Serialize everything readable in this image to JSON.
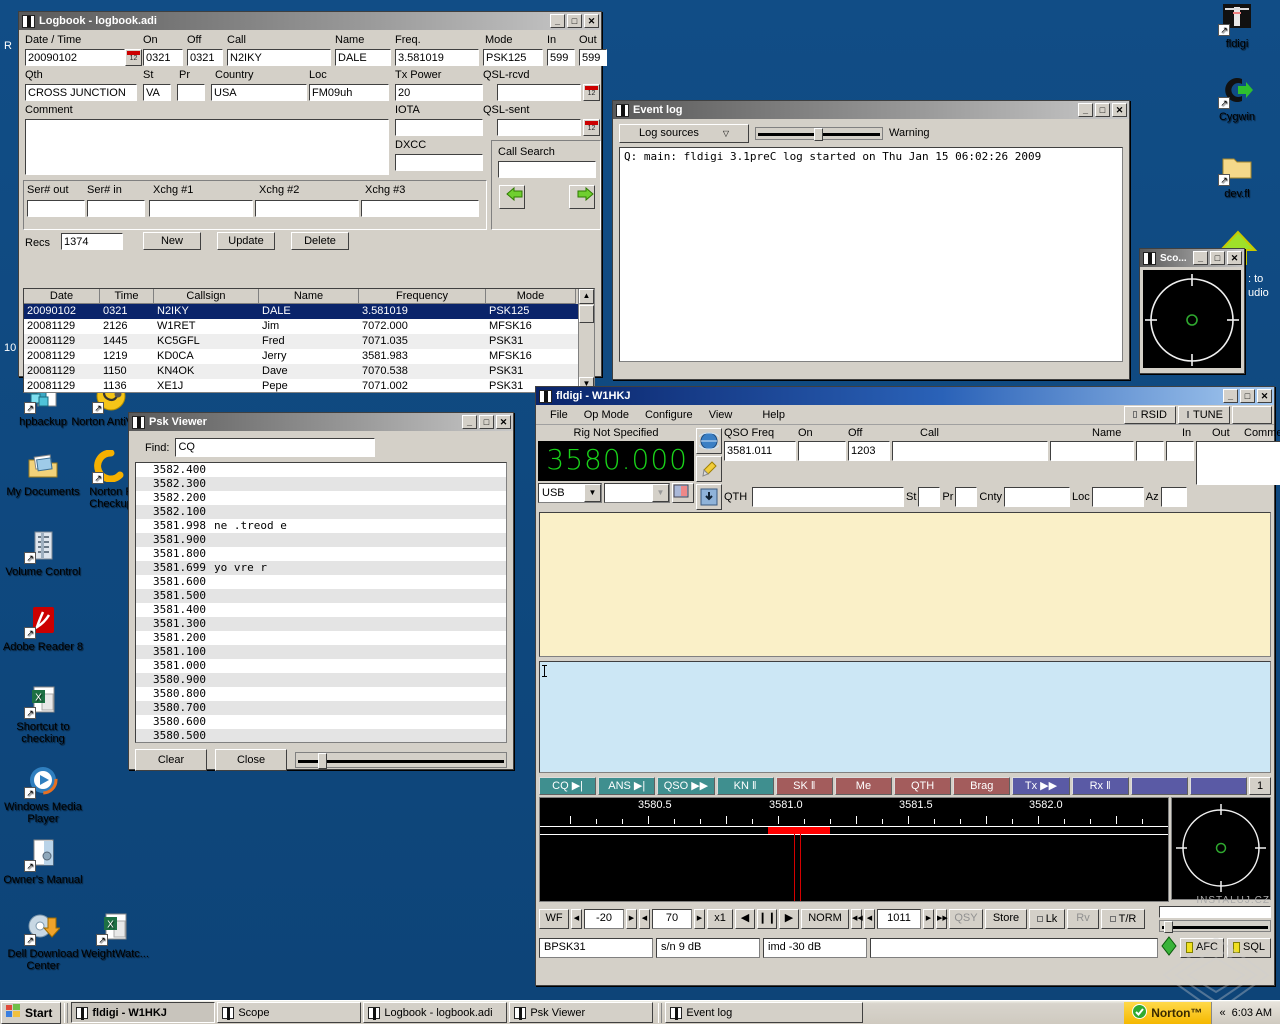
{
  "desktop": {
    "background_color": "#14538c",
    "icons_left": [
      {
        "label": "hpbackup",
        "icon": "backup-icon"
      },
      {
        "label": "Norton AntiVirus",
        "icon": "norton-antivirus-icon"
      },
      {
        "label": "My Documents",
        "icon": "my-documents-icon"
      },
      {
        "label": "Norton P Checkup",
        "icon": "norton-checkup-icon"
      },
      {
        "label": "Volume Control",
        "icon": "volume-control-icon"
      },
      {
        "label": "Adobe Reader 8",
        "icon": "adobe-reader-icon"
      },
      {
        "label": "Shortcut to checking",
        "icon": "excel-sheet-icon"
      },
      {
        "label": "Windows Media Player",
        "icon": "media-player-icon"
      },
      {
        "label": "Owner's Manual",
        "icon": "manual-icon"
      },
      {
        "label": "Dell Download Center",
        "icon": "dell-download-icon"
      },
      {
        "label": "WeightWatc...",
        "icon": "excel-sheet-icon"
      }
    ],
    "icons_right": [
      {
        "label": "fldigi",
        "icon": "fldigi-icon"
      },
      {
        "label": "Cygwin",
        "icon": "cygwin-icon"
      },
      {
        "label": "dev.fl",
        "icon": "folder-icon"
      }
    ],
    "clipped_labels": {
      "left_edge_top": "R",
      "left_edge_mid": "10",
      "right_clip_1": ": to",
      "right_clip_2": "udio"
    }
  },
  "logbook": {
    "title": "Logbook - logbook.adi",
    "labels": {
      "datetime": "Date / Time",
      "on": "On",
      "off": "Off",
      "call": "Call",
      "name": "Name",
      "freq": "Freq.",
      "mode": "Mode",
      "in": "In",
      "out": "Out",
      "qth": "Qth",
      "st": "St",
      "pr": "Pr",
      "country": "Country",
      "loc": "Loc",
      "txpower": "Tx Power",
      "qsl_rcvd": "QSL-rcvd",
      "comment": "Comment",
      "iota": "IOTA",
      "dxcc": "DXCC",
      "qsl_sent": "QSL-sent",
      "call_search": "Call Search",
      "ser_out": "Ser# out",
      "ser_in": "Ser# in",
      "xchg1": "Xchg #1",
      "xchg2": "Xchg #2",
      "xchg3": "Xchg #3",
      "recs": "Recs"
    },
    "values": {
      "datetime": "20090102",
      "on": "0321",
      "off": "0321",
      "call": "N2IKY",
      "name": "DALE",
      "freq": "3.581019",
      "mode": "PSK125",
      "in": "599",
      "out": "599",
      "qth": "CROSS JUNCTION",
      "st": "VA",
      "pr": "",
      "country": "USA",
      "loc": "FM09uh",
      "txpower": "20",
      "qsl_rcvd": "",
      "comment": "",
      "iota": "",
      "dxcc": "",
      "qsl_sent": "",
      "call_search": "",
      "ser_out": "",
      "ser_in": "",
      "xchg1": "",
      "xchg2": "",
      "xchg3": "",
      "recs": "1374"
    },
    "buttons": {
      "new": "New",
      "update": "Update",
      "delete": "Delete"
    },
    "table": {
      "headers": [
        "Date",
        "Time",
        "Callsign",
        "Name",
        "Frequency",
        "Mode"
      ],
      "rows": [
        {
          "date": "20090102",
          "time": "0321",
          "callsign": "N2IKY",
          "name": "DALE",
          "frequency": "3.581019",
          "mode": "PSK125",
          "selected": true
        },
        {
          "date": "20081129",
          "time": "2126",
          "callsign": "W1RET",
          "name": "Jim",
          "frequency": "7072.000",
          "mode": "MFSK16",
          "selected": false
        },
        {
          "date": "20081129",
          "time": "1445",
          "callsign": "KC5GFL",
          "name": "Fred",
          "frequency": "7071.035",
          "mode": "PSK31",
          "selected": false
        },
        {
          "date": "20081129",
          "time": "1219",
          "callsign": "KD0CA",
          "name": "Jerry",
          "frequency": "3581.983",
          "mode": "MFSK16",
          "selected": false
        },
        {
          "date": "20081129",
          "time": "1150",
          "callsign": "KN4OK",
          "name": "Dave",
          "frequency": "7070.538",
          "mode": "PSK31",
          "selected": false
        },
        {
          "date": "20081129",
          "time": "1136",
          "callsign": "XE1J",
          "name": "Pepe",
          "frequency": "7071.002",
          "mode": "PSK31",
          "selected": false
        }
      ]
    }
  },
  "eventlog": {
    "title": "Event log",
    "log_sources_label": "Log sources",
    "level_label": "Warning",
    "text": "Q: main: fldigi 3.1preC log started on Thu Jan 15 06:02:26 2009"
  },
  "scope": {
    "title": "Sco..."
  },
  "pskviewer": {
    "title": "Psk Viewer",
    "find_label": "Find:",
    "find_value": "CQ",
    "buttons": {
      "clear": "Clear",
      "close": "Close"
    },
    "rows": [
      {
        "freq": "3582.400",
        "text": ""
      },
      {
        "freq": "3582.300",
        "text": ""
      },
      {
        "freq": "3582.200",
        "text": ""
      },
      {
        "freq": "3582.100",
        "text": ""
      },
      {
        "freq": "3581.998",
        "text": "ne .treod e"
      },
      {
        "freq": "3581.900",
        "text": ""
      },
      {
        "freq": "3581.800",
        "text": ""
      },
      {
        "freq": "3581.699",
        "text": "yo   vre r"
      },
      {
        "freq": "3581.600",
        "text": ""
      },
      {
        "freq": "3581.500",
        "text": ""
      },
      {
        "freq": "3581.400",
        "text": ""
      },
      {
        "freq": "3581.300",
        "text": ""
      },
      {
        "freq": "3581.200",
        "text": ""
      },
      {
        "freq": "3581.100",
        "text": ""
      },
      {
        "freq": "3581.000",
        "text": ""
      },
      {
        "freq": "3580.900",
        "text": ""
      },
      {
        "freq": "3580.800",
        "text": ""
      },
      {
        "freq": "3580.700",
        "text": ""
      },
      {
        "freq": "3580.600",
        "text": ""
      },
      {
        "freq": "3580.500",
        "text": ""
      }
    ]
  },
  "fldigi": {
    "title": "fldigi - W1HKJ",
    "menu": [
      "File",
      "Op Mode",
      "Configure",
      "View",
      "Help"
    ],
    "toggles": [
      {
        "label": "RSID",
        "checked": false
      },
      {
        "label": "TUNE",
        "checked": false
      }
    ],
    "rig": {
      "status": "Rig Not Specified",
      "frequency": "3580.000",
      "mode_select": "USB",
      "band_select": ""
    },
    "qso": {
      "labels": {
        "freq": "QSO Freq",
        "on": "On",
        "off": "Off",
        "call": "Call",
        "name": "Name",
        "in": "In",
        "out": "Out",
        "comment": "Comment",
        "qth": "QTH",
        "st": "St",
        "pr": "Pr",
        "cnty": "Cnty",
        "loc": "Loc",
        "az": "Az"
      },
      "values": {
        "freq": "3581.011",
        "on": "",
        "off": "1203",
        "call": "",
        "name": "",
        "in": "",
        "out": "",
        "comment": "",
        "qth": "",
        "st": "",
        "pr": "",
        "cnty": "",
        "loc": "",
        "az": ""
      }
    },
    "macros": [
      {
        "label": "CQ ▶|",
        "color": "#3f8f8f"
      },
      {
        "label": "ANS ▶|",
        "color": "#3f8f8f"
      },
      {
        "label": "QSO ▶▶",
        "color": "#3f8f8f"
      },
      {
        "label": "KN ‖",
        "color": "#3f8f8f"
      },
      {
        "label": "SK ‖",
        "color": "#a35c5c"
      },
      {
        "label": "Me",
        "color": "#a35c5c"
      },
      {
        "label": "QTH",
        "color": "#a35c5c"
      },
      {
        "label": "Brag",
        "color": "#a35c5c"
      },
      {
        "label": "Tx ▶▶",
        "color": "#5a5aa5"
      },
      {
        "label": "Rx ‖",
        "color": "#5a5aa5"
      },
      {
        "label": "",
        "color": "#5a5aa5"
      },
      {
        "label": "",
        "color": "#5a5aa5"
      }
    ],
    "macro_set": "1",
    "waterfall": {
      "scale_labels": [
        "3580.5",
        "3581.0",
        "3581.5",
        "3582.0"
      ],
      "cursor_freq": "3581.0"
    },
    "wf_controls": {
      "wf_button": "WF",
      "level": "-20",
      "contrast": "70",
      "zoom": "x1",
      "norm": "NORM",
      "carrier": "1011",
      "qsy": "QSY",
      "store": "Store",
      "lk": "Lk",
      "rv": "Rv",
      "tr": "T/R"
    },
    "status": {
      "mode": "BPSK31",
      "snr": "s/n  9 dB",
      "imd": "imd -30 dB",
      "message": "",
      "afc": "AFC",
      "sql": "SQL"
    }
  },
  "taskbar": {
    "start_label": "Start",
    "tasks": [
      {
        "label": "fldigi - W1HKJ",
        "active": true
      },
      {
        "label": "Scope",
        "active": false
      },
      {
        "label": "Logbook - logbook.adi",
        "active": false
      },
      {
        "label": "Psk Viewer",
        "active": false
      },
      {
        "label": "Event log",
        "active": false
      }
    ],
    "norton_label": "Norton™",
    "clock": "6:03 AM",
    "tray_chevron": "«"
  },
  "watermark": {
    "text": "INSTALUJ.CZ"
  }
}
